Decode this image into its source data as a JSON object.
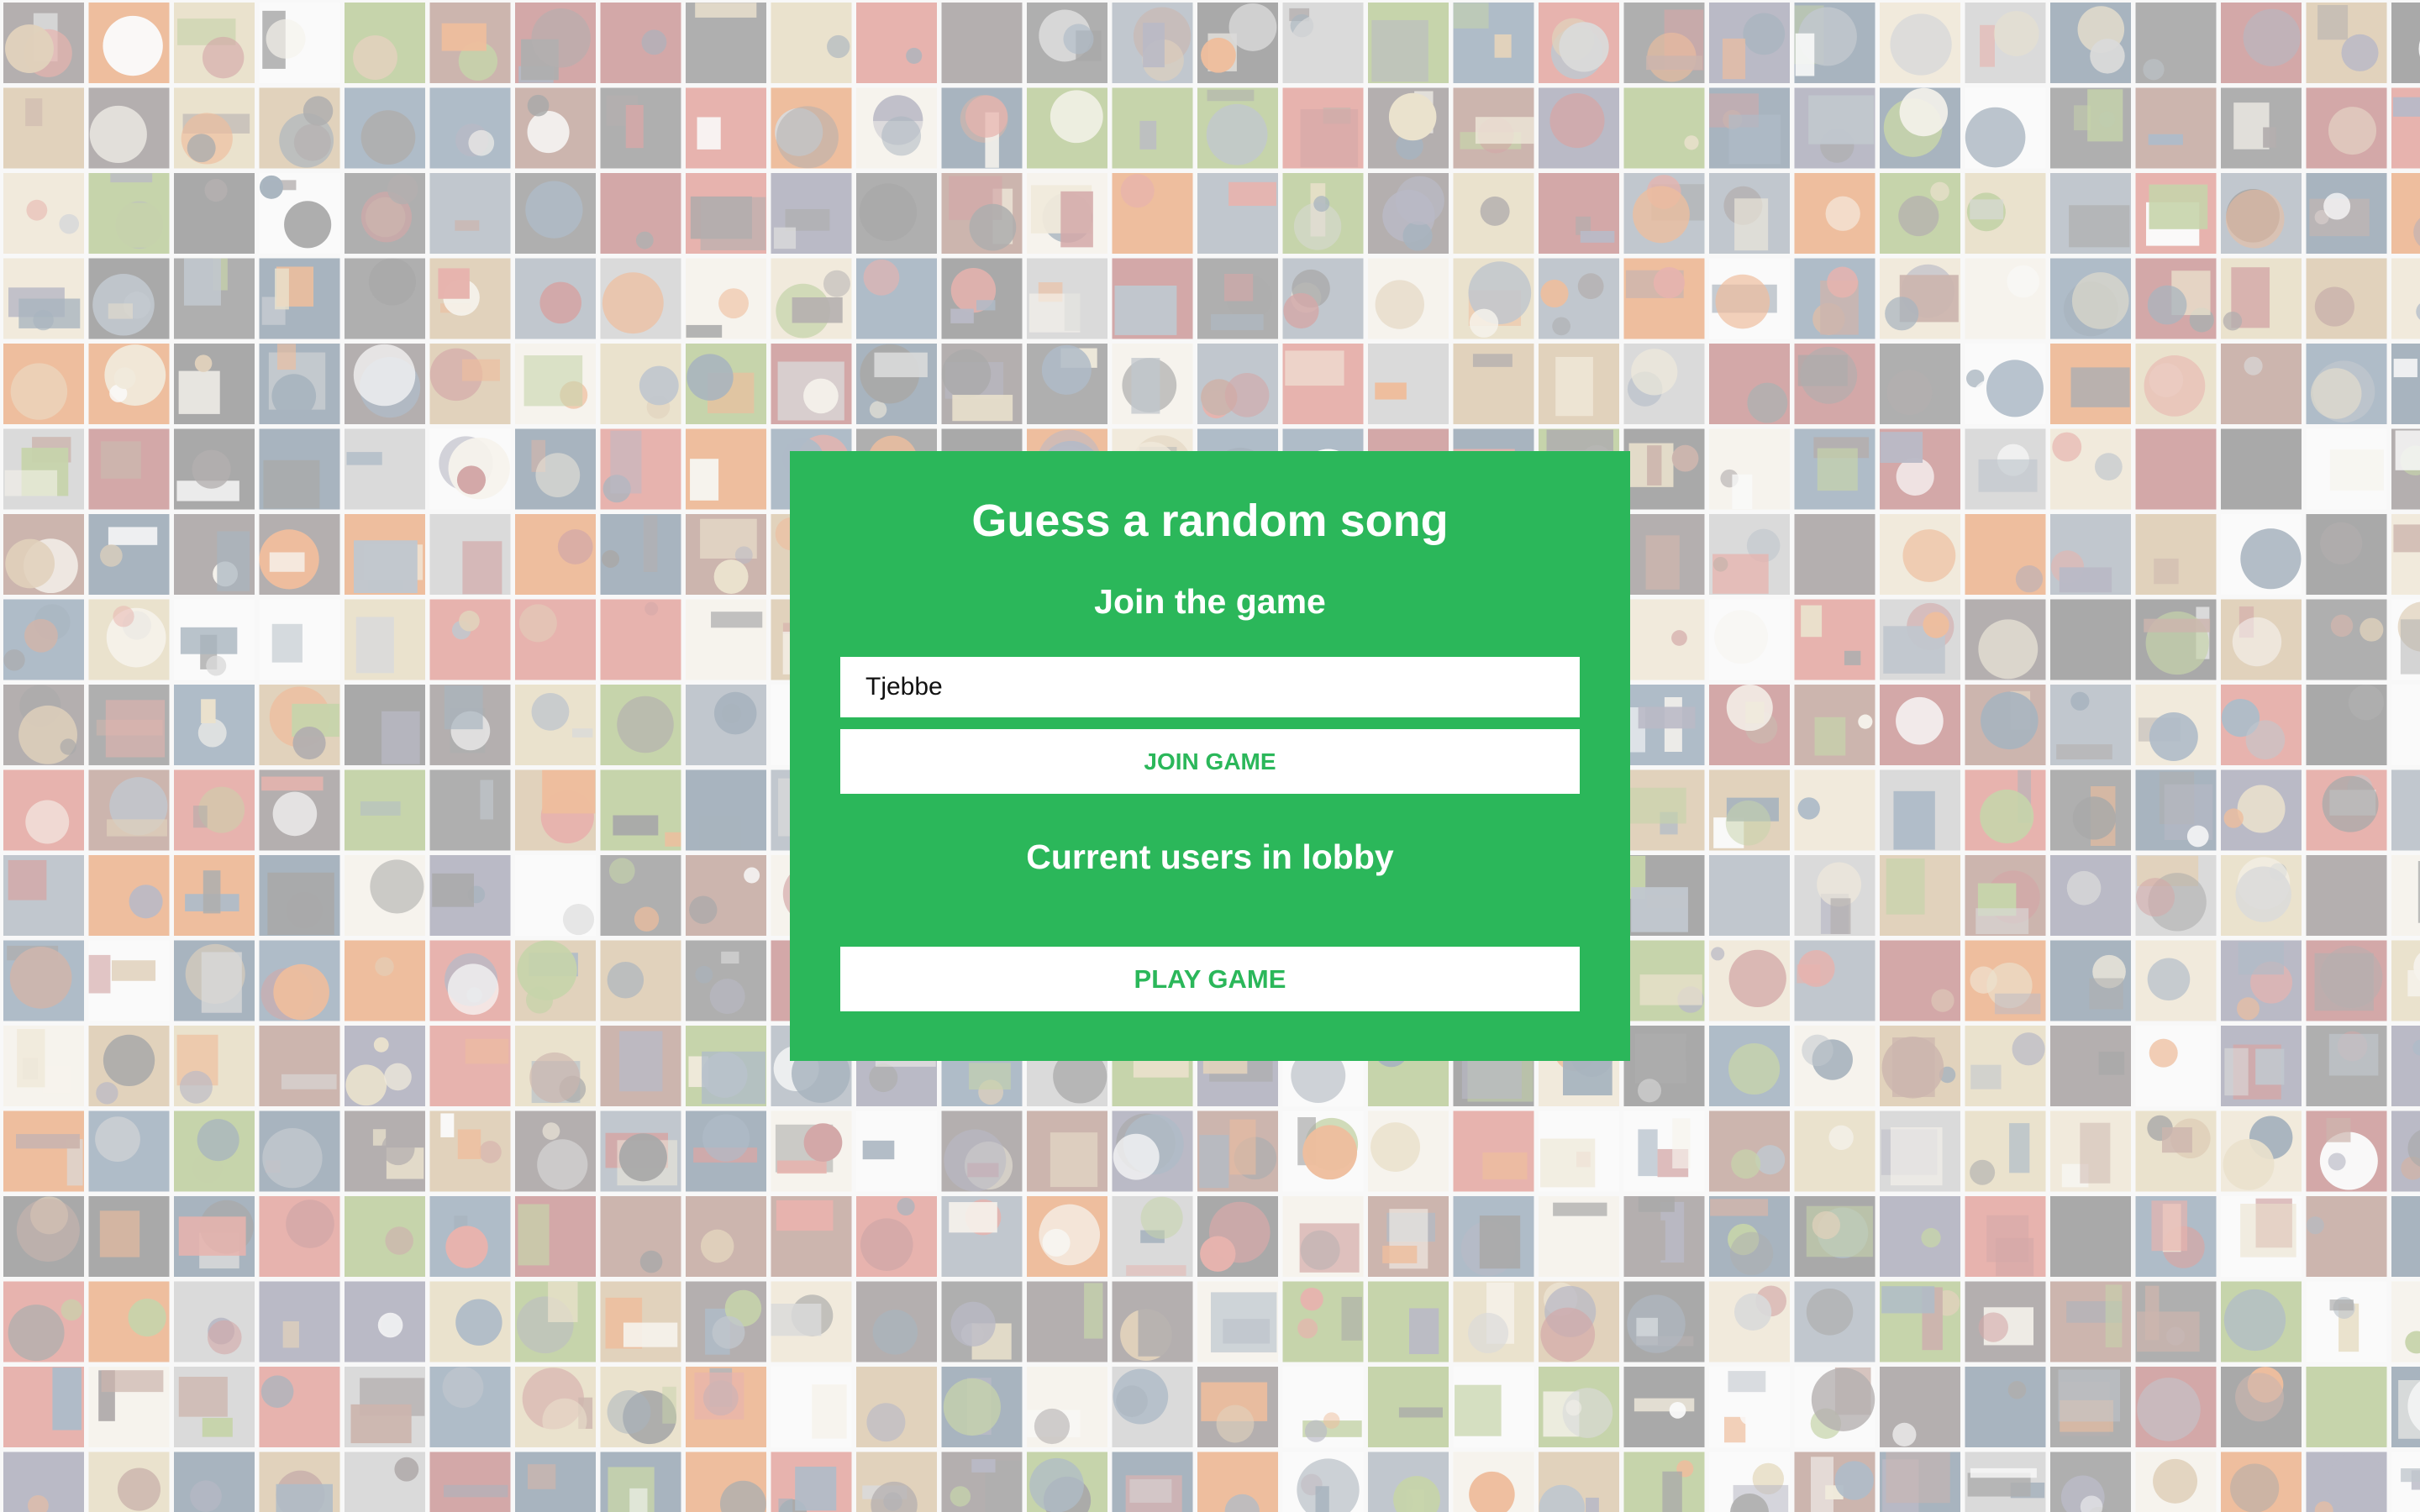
{
  "colors": {
    "card_green": "#2bb75a",
    "button_text": "#2bb75a",
    "button_bg": "#ffffff",
    "heading_text": "#ffffff"
  },
  "background": {
    "description_icon": "album-cover-mosaic"
  },
  "card": {
    "title": "Guess a random song",
    "join_heading": "Join the game",
    "name_input_value": "Tjebbe",
    "join_button_label": "JOIN GAME",
    "lobby_heading": "Current users in lobby",
    "lobby_users": [],
    "play_button_label": "PLAY GAME"
  }
}
